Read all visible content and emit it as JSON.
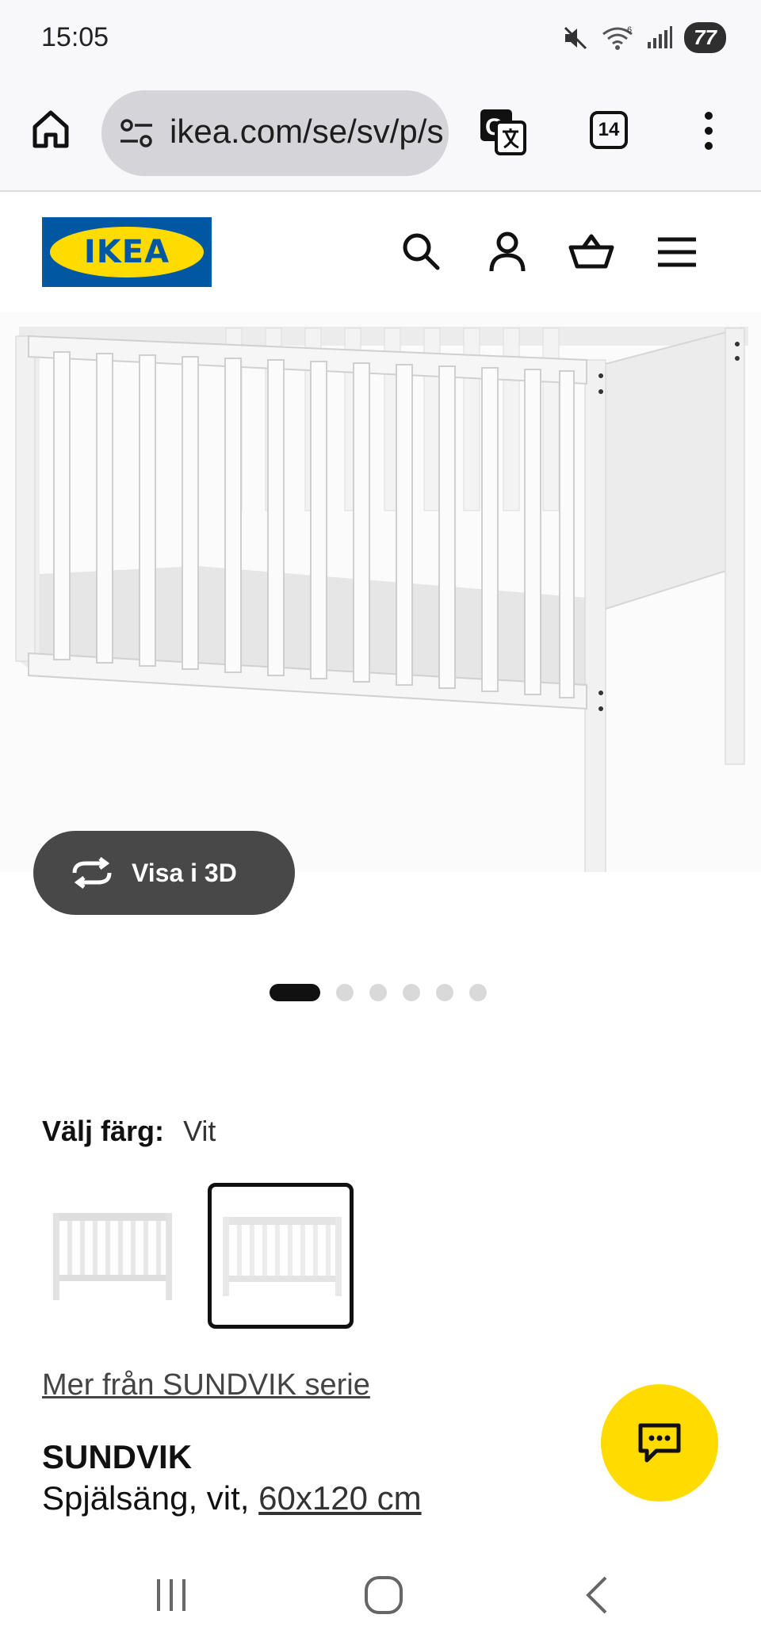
{
  "status_bar": {
    "time": "15:05",
    "wifi_badge": "6",
    "battery": "77",
    "icons": [
      "mute-icon",
      "wifi-icon",
      "signal-icon",
      "battery-icon"
    ]
  },
  "browser": {
    "url": "ikea.com/se/sv/p/s",
    "tab_count": "14",
    "icons": [
      "home-icon",
      "site-settings-icon",
      "translate-icon",
      "more-vert-icon"
    ]
  },
  "site_header": {
    "logo_text": "IKEA",
    "brand_colors": {
      "blue": "#0058a3",
      "yellow": "#ffdb00"
    },
    "icons": [
      "search-icon",
      "account-icon",
      "cart-icon",
      "menu-icon"
    ]
  },
  "gallery": {
    "view3d_label": "Visa i 3D",
    "image_count": 6,
    "active_index": 0
  },
  "color_picker": {
    "label": "Välj färg:",
    "value": "Vit",
    "selected_swatch": 1
  },
  "product": {
    "series_link": "Mer från SUNDVIK serie",
    "name": "SUNDVIK",
    "desc_prefix": "Spjälsäng, vit,",
    "size": "60x120 cm"
  },
  "chat_fab": {
    "icon": "chat-icon",
    "color": "#ffdb00"
  },
  "nav_bar": {
    "icons": [
      "recents-icon",
      "home-nav-icon",
      "back-icon"
    ]
  }
}
